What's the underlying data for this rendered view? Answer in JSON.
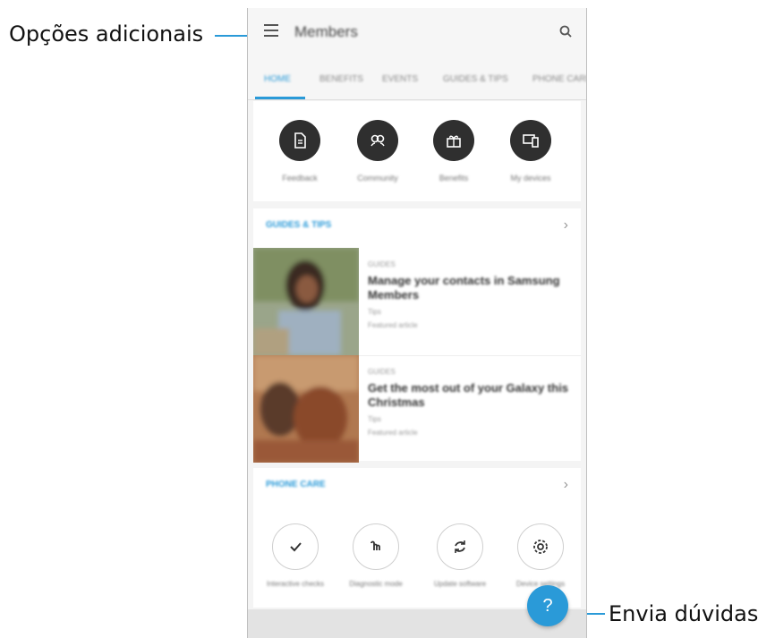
{
  "callouts": {
    "left_label": "Opções adicionais",
    "right_label": "Envia dúvidas"
  },
  "app": {
    "title": "Members",
    "menu_icon": "hamburger-menu-icon",
    "search_icon": "search-icon"
  },
  "tabs": [
    "HOME",
    "BENEFITS",
    "EVENTS",
    "GUIDES & TIPS",
    "PHONE CARE"
  ],
  "shortcuts": [
    {
      "label": "Feedback",
      "icon": "document-icon"
    },
    {
      "label": "Community",
      "icon": "community-icon"
    },
    {
      "label": "Benefits",
      "icon": "gift-icon"
    },
    {
      "label": "My devices",
      "icon": "devices-icon"
    }
  ],
  "guides": {
    "title": "GUIDES & TIPS",
    "articles": [
      {
        "tag": "GUIDES",
        "title": "Manage your contacts in Samsung Members",
        "sub": "Tips",
        "meta": "Featured article"
      },
      {
        "tag": "GUIDES",
        "title": "Get the most out of your Galaxy this Christmas",
        "sub": "Tips",
        "meta": "Featured article"
      }
    ]
  },
  "phone_care": {
    "title": "PHONE CARE",
    "items": [
      {
        "label": "Interactive checks",
        "icon": "checkmark-icon"
      },
      {
        "label": "Diagnostic mode",
        "icon": "touch-icon"
      },
      {
        "label": "Update software",
        "icon": "sync-icon"
      },
      {
        "label": "Device settings",
        "icon": "gear-icon"
      }
    ]
  },
  "fab": {
    "label": "?",
    "icon": "help-icon"
  },
  "colors": {
    "accent": "#2a9ad8",
    "dark_circle": "#2f2f2f"
  }
}
